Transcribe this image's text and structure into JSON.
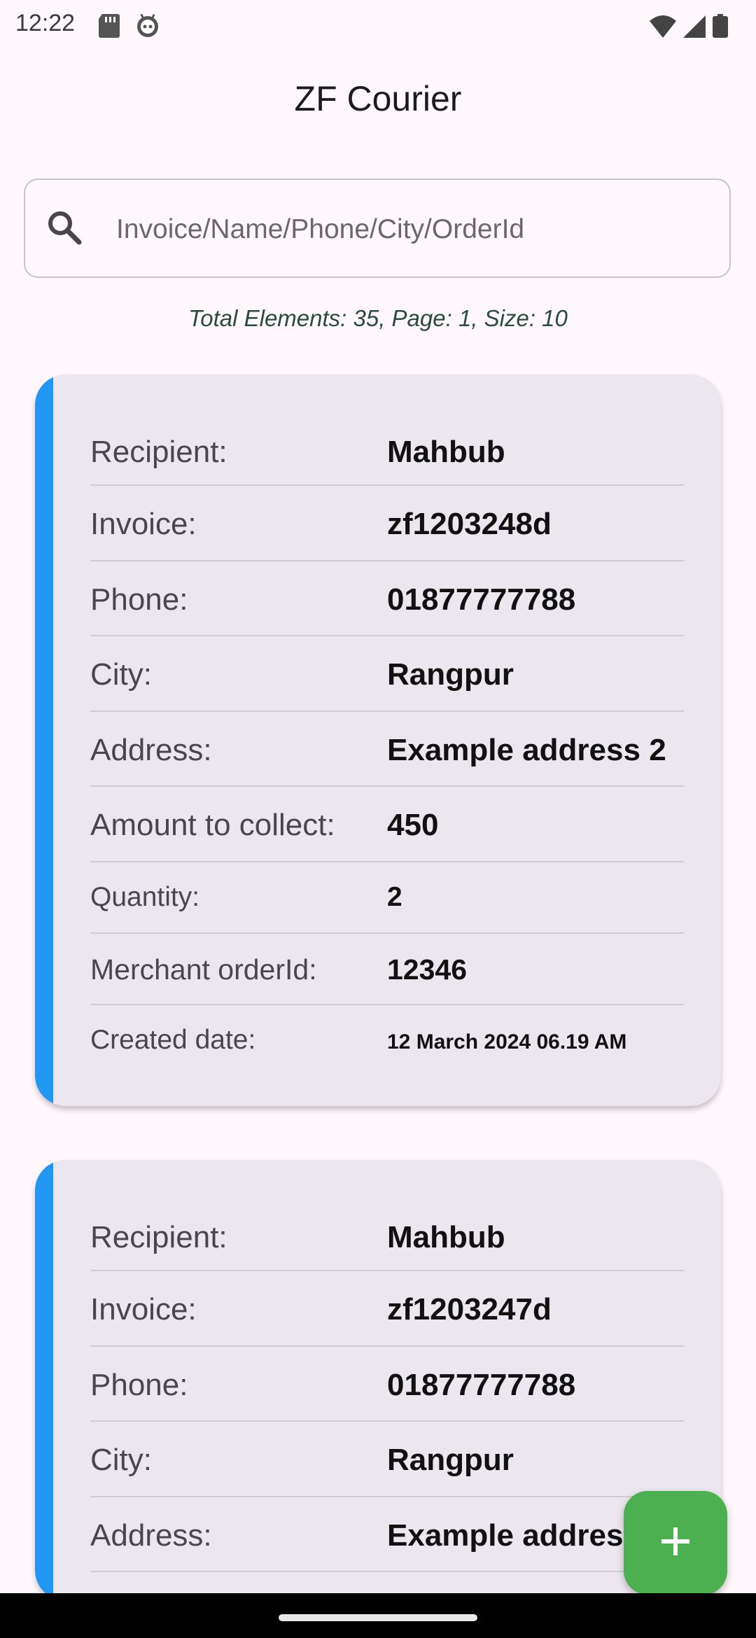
{
  "status_bar": {
    "time": "12:22"
  },
  "app_bar": {
    "title": "ZF Courier"
  },
  "search": {
    "placeholder": "Invoice/Name/Phone/City/OrderId"
  },
  "pagination": {
    "summary": "Total Elements: 35, Page: 1, Size: 10"
  },
  "colors": {
    "accent": "#2196F3",
    "fab": "#4CAF50",
    "card_bg": "#ECE6EF",
    "page_bg": "#FEF7FC"
  },
  "orders": [
    {
      "rows": [
        {
          "label": "Recipient:",
          "value": "Mahbub"
        },
        {
          "label": "Invoice:",
          "value": "zf1203248d"
        },
        {
          "label": "Phone:",
          "value": "01877777788"
        },
        {
          "label": "City:",
          "value": "Rangpur"
        },
        {
          "label": "Address:",
          "value": "Example address 2"
        },
        {
          "label": "Amount to collect:",
          "value": "450"
        },
        {
          "label": "Quantity:",
          "value": "2"
        },
        {
          "label": "Merchant orderId:",
          "value": "12346"
        },
        {
          "label": "Created date:",
          "value": "12 March 2024 06.19 AM"
        }
      ]
    },
    {
      "rows": [
        {
          "label": "Recipient:",
          "value": "Mahbub"
        },
        {
          "label": "Invoice:",
          "value": "zf1203247d"
        },
        {
          "label": "Phone:",
          "value": "01877777788"
        },
        {
          "label": "City:",
          "value": "Rangpur"
        },
        {
          "label": "Address:",
          "value": "Example address 2"
        }
      ]
    }
  ],
  "fab": {
    "icon": "plus-icon"
  }
}
